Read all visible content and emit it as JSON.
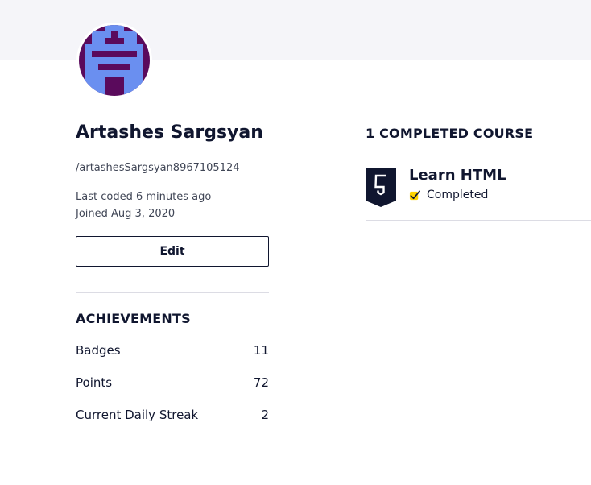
{
  "profile": {
    "name": "Artashes Sargsyan",
    "handle": "/artashesSargsyan8967105124",
    "last_coded": "Last coded 6 minutes ago",
    "joined": "Joined Aug 3, 2020",
    "edit_label": "Edit",
    "avatar_icon": "pixel-robot-avatar",
    "avatar_colors": {
      "background": "#5a0a5c",
      "pixels": "#6a8ff0"
    }
  },
  "achievements": {
    "title": "ACHIEVEMENTS",
    "items": [
      {
        "label": "Badges",
        "value": "11"
      },
      {
        "label": "Points",
        "value": "72"
      },
      {
        "label": "Current Daily Streak",
        "value": "2"
      }
    ]
  },
  "courses": {
    "title": "1 COMPLETED COURSE",
    "items": [
      {
        "name": "Learn HTML",
        "status": "Completed",
        "icon": "html5-badge-icon",
        "status_icon": "check-icon",
        "icon_color": "#10162f",
        "check_color": "#ffd300"
      }
    ]
  }
}
